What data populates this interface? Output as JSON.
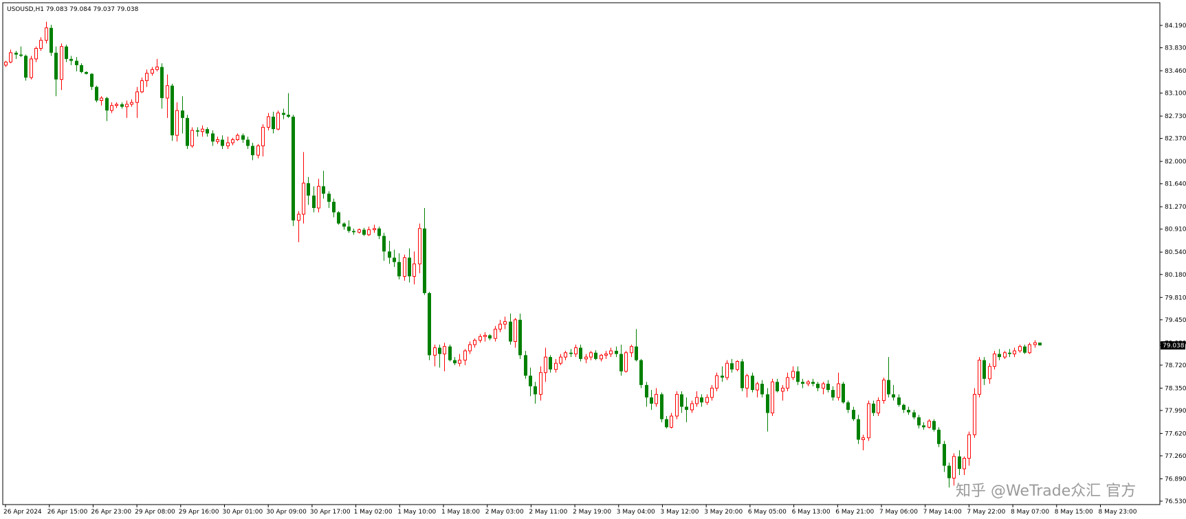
{
  "chart_data": {
    "type": "candlestick",
    "title": "USOUSD,H1  79.083 79.084 79.037 79.038",
    "symbol": "USOUSD",
    "timeframe": "H1",
    "last_price_label": "79.038",
    "watermark": "知乎 @WeTrade众汇 官方",
    "y_range": [
      76.53,
      84.45
    ],
    "y_ticks": [
      "84.190",
      "83.830",
      "83.460",
      "83.100",
      "82.730",
      "82.370",
      "82.000",
      "81.640",
      "81.270",
      "80.910",
      "80.540",
      "80.180",
      "79.810",
      "79.450",
      "79.080",
      "78.720",
      "78.350",
      "77.990",
      "77.620",
      "77.260",
      "76.890",
      "76.530"
    ],
    "x_labels": [
      "26 Apr 2024",
      "26 Apr 15:00",
      "26 Apr 23:00",
      "29 Apr 08:00",
      "29 Apr 16:00",
      "30 Apr 01:00",
      "30 Apr 09:00",
      "30 Apr 17:00",
      "1 May 02:00",
      "1 May 10:00",
      "1 May 18:00",
      "2 May 03:00",
      "2 May 11:00",
      "2 May 19:00",
      "3 May 04:00",
      "3 May 12:00",
      "3 May 20:00",
      "6 May 05:00",
      "6 May 13:00",
      "6 May 21:00",
      "7 May 06:00",
      "7 May 14:00",
      "7 May 22:00",
      "8 May 07:00",
      "8 May 15:00",
      "8 May 23:00"
    ],
    "up_color": "#ff0000",
    "down_color": "#008000",
    "grid": false,
    "candles": [
      [
        83.55,
        83.62,
        83.52,
        83.6
      ],
      [
        83.6,
        83.8,
        83.58,
        83.75
      ],
      [
        83.75,
        83.78,
        83.65,
        83.72
      ],
      [
        83.72,
        83.85,
        83.68,
        83.7
      ],
      [
        83.7,
        83.72,
        83.3,
        83.35
      ],
      [
        83.35,
        83.7,
        83.32,
        83.65
      ],
      [
        83.65,
        83.85,
        83.6,
        83.82
      ],
      [
        83.82,
        84.0,
        83.78,
        83.95
      ],
      [
        83.95,
        84.25,
        83.9,
        84.15
      ],
      [
        84.15,
        84.2,
        83.7,
        83.75
      ],
      [
        83.75,
        83.85,
        83.05,
        83.32
      ],
      [
        83.32,
        83.9,
        83.15,
        83.85
      ],
      [
        83.85,
        83.88,
        83.6,
        83.65
      ],
      [
        83.65,
        83.7,
        83.55,
        83.62
      ],
      [
        83.62,
        83.68,
        83.45,
        83.55
      ],
      [
        83.55,
        83.58,
        83.42,
        83.44
      ],
      [
        83.44,
        83.45,
        83.4,
        83.41
      ],
      [
        83.41,
        83.42,
        83.15,
        83.2
      ],
      [
        83.2,
        83.22,
        82.95,
        82.98
      ],
      [
        82.98,
        83.05,
        82.9,
        83.02
      ],
      [
        83.02,
        83.04,
        82.65,
        82.82
      ],
      [
        82.82,
        82.95,
        82.78,
        82.9
      ],
      [
        82.9,
        82.95,
        82.86,
        82.92
      ],
      [
        82.92,
        82.95,
        82.85,
        82.88
      ],
      [
        82.88,
        82.98,
        82.7,
        82.92
      ],
      [
        82.92,
        83.0,
        82.88,
        82.95
      ],
      [
        82.95,
        83.2,
        82.7,
        83.12
      ],
      [
        83.12,
        83.35,
        83.1,
        83.3
      ],
      [
        83.3,
        83.48,
        83.2,
        83.42
      ],
      [
        83.42,
        83.52,
        83.38,
        83.48
      ],
      [
        83.48,
        83.65,
        83.45,
        83.52
      ],
      [
        83.52,
        83.58,
        82.85,
        83.02
      ],
      [
        83.02,
        83.4,
        82.7,
        83.22
      ],
      [
        83.22,
        83.25,
        82.33,
        82.42
      ],
      [
        82.42,
        82.95,
        82.32,
        82.82
      ],
      [
        82.82,
        83.05,
        82.45,
        82.7
      ],
      [
        82.7,
        82.75,
        82.2,
        82.25
      ],
      [
        82.25,
        82.55,
        82.22,
        82.5
      ],
      [
        82.5,
        82.55,
        82.4,
        82.48
      ],
      [
        82.48,
        82.58,
        82.4,
        82.52
      ],
      [
        82.52,
        82.55,
        82.4,
        82.45
      ],
      [
        82.45,
        82.5,
        82.25,
        82.32
      ],
      [
        82.32,
        82.4,
        82.28,
        82.35
      ],
      [
        82.35,
        82.42,
        82.2,
        82.25
      ],
      [
        82.25,
        82.4,
        82.2,
        82.3
      ],
      [
        82.3,
        82.38,
        82.26,
        82.35
      ],
      [
        82.35,
        82.45,
        82.33,
        82.42
      ],
      [
        82.42,
        82.45,
        82.3,
        82.35
      ],
      [
        82.35,
        82.4,
        82.2,
        82.25
      ],
      [
        82.25,
        82.3,
        82.02,
        82.1
      ],
      [
        82.1,
        82.28,
        82.05,
        82.25
      ],
      [
        82.25,
        82.6,
        82.08,
        82.55
      ],
      [
        82.55,
        82.78,
        82.5,
        82.72
      ],
      [
        82.72,
        82.8,
        82.45,
        82.52
      ],
      [
        82.52,
        82.82,
        82.5,
        82.78
      ],
      [
        82.78,
        82.85,
        82.68,
        82.75
      ],
      [
        82.75,
        83.1,
        82.7,
        82.72
      ],
      [
        82.72,
        82.75,
        80.96,
        81.05
      ],
      [
        81.05,
        81.2,
        80.7,
        81.15
      ],
      [
        81.15,
        82.15,
        81.0,
        81.65
      ],
      [
        81.65,
        81.75,
        81.3,
        81.45
      ],
      [
        81.45,
        81.6,
        81.18,
        81.25
      ],
      [
        81.25,
        81.72,
        81.18,
        81.6
      ],
      [
        81.6,
        81.85,
        81.4,
        81.48
      ],
      [
        81.48,
        81.52,
        81.25,
        81.35
      ],
      [
        81.35,
        81.4,
        81.1,
        81.18
      ],
      [
        81.18,
        81.2,
        80.98,
        81.0
      ],
      [
        81.0,
        81.02,
        80.9,
        80.95
      ],
      [
        80.95,
        81.05,
        80.85,
        80.88
      ],
      [
        80.88,
        80.92,
        80.82,
        80.86
      ],
      [
        80.86,
        80.92,
        80.84,
        80.9
      ],
      [
        80.9,
        80.93,
        80.8,
        80.82
      ],
      [
        80.82,
        80.95,
        80.8,
        80.9
      ],
      [
        80.9,
        80.98,
        80.85,
        80.92
      ],
      [
        80.92,
        80.95,
        80.75,
        80.8
      ],
      [
        80.8,
        80.85,
        80.4,
        80.55
      ],
      [
        80.55,
        80.72,
        80.35,
        80.45
      ],
      [
        80.45,
        80.58,
        80.3,
        80.38
      ],
      [
        80.38,
        80.52,
        80.1,
        80.15
      ],
      [
        80.15,
        80.5,
        80.08,
        80.45
      ],
      [
        80.45,
        80.6,
        80.05,
        80.15
      ],
      [
        80.15,
        80.55,
        80.02,
        80.35
      ],
      [
        80.35,
        81.0,
        80.2,
        80.92
      ],
      [
        80.92,
        81.25,
        79.85,
        79.88
      ],
      [
        79.88,
        79.9,
        78.8,
        78.88
      ],
      [
        78.88,
        79.05,
        78.7,
        79.0
      ],
      [
        79.0,
        79.05,
        78.68,
        78.9
      ],
      [
        78.9,
        79.08,
        78.62,
        79.02
      ],
      [
        79.02,
        79.05,
        78.78,
        78.8
      ],
      [
        78.8,
        78.85,
        78.72,
        78.75
      ],
      [
        78.75,
        78.9,
        78.7,
        78.8
      ],
      [
        78.8,
        78.98,
        78.72,
        78.95
      ],
      [
        78.95,
        79.1,
        78.9,
        79.05
      ],
      [
        79.05,
        79.15,
        79.0,
        79.12
      ],
      [
        79.12,
        79.22,
        79.08,
        79.18
      ],
      [
        79.18,
        79.25,
        79.1,
        79.2
      ],
      [
        79.2,
        79.22,
        79.12,
        79.15
      ],
      [
        79.15,
        79.35,
        79.1,
        79.3
      ],
      [
        79.3,
        79.45,
        79.25,
        79.38
      ],
      [
        79.38,
        79.5,
        79.3,
        79.42
      ],
      [
        79.42,
        79.55,
        79.05,
        79.1
      ],
      [
        79.1,
        79.48,
        79.0,
        79.45
      ],
      [
        79.45,
        79.55,
        78.82,
        78.88
      ],
      [
        78.88,
        78.95,
        78.5,
        78.55
      ],
      [
        78.55,
        78.68,
        78.22,
        78.38
      ],
      [
        78.38,
        78.45,
        78.1,
        78.25
      ],
      [
        78.25,
        78.7,
        78.15,
        78.6
      ],
      [
        78.6,
        79.0,
        78.45,
        78.85
      ],
      [
        78.85,
        78.88,
        78.6,
        78.65
      ],
      [
        78.65,
        78.82,
        78.6,
        78.75
      ],
      [
        78.75,
        78.9,
        78.72,
        78.85
      ],
      [
        78.85,
        78.95,
        78.8,
        78.92
      ],
      [
        78.92,
        78.98,
        78.85,
        78.9
      ],
      [
        78.9,
        79.05,
        78.85,
        79.0
      ],
      [
        79.0,
        79.05,
        78.78,
        78.82
      ],
      [
        78.82,
        78.9,
        78.75,
        78.85
      ],
      [
        78.85,
        78.95,
        78.8,
        78.92
      ],
      [
        78.92,
        78.96,
        78.8,
        78.82
      ],
      [
        78.82,
        78.9,
        78.78,
        78.88
      ],
      [
        78.88,
        78.95,
        78.82,
        78.9
      ],
      [
        78.9,
        79.0,
        78.85,
        78.95
      ],
      [
        78.95,
        79.02,
        78.85,
        78.9
      ],
      [
        78.9,
        79.05,
        78.55,
        78.62
      ],
      [
        78.62,
        78.95,
        78.6,
        78.92
      ],
      [
        78.92,
        79.05,
        78.85,
        79.02
      ],
      [
        79.02,
        79.3,
        78.78,
        78.8
      ],
      [
        78.8,
        78.82,
        78.35,
        78.4
      ],
      [
        78.4,
        78.45,
        78.05,
        78.2
      ],
      [
        78.2,
        78.32,
        78.0,
        78.1
      ],
      [
        78.1,
        78.35,
        78.05,
        78.25
      ],
      [
        78.25,
        78.28,
        77.8,
        77.85
      ],
      [
        77.85,
        77.9,
        77.7,
        77.72
      ],
      [
        77.72,
        77.95,
        77.7,
        77.9
      ],
      [
        77.9,
        78.3,
        77.85,
        78.25
      ],
      [
        78.25,
        78.3,
        77.95,
        78.05
      ],
      [
        78.05,
        78.2,
        77.8,
        78.0
      ],
      [
        78.0,
        78.15,
        77.95,
        78.1
      ],
      [
        78.1,
        78.3,
        78.05,
        78.2
      ],
      [
        78.2,
        78.25,
        78.05,
        78.12
      ],
      [
        78.12,
        78.25,
        78.08,
        78.2
      ],
      [
        78.2,
        78.4,
        78.15,
        78.35
      ],
      [
        78.35,
        78.6,
        78.3,
        78.55
      ],
      [
        78.55,
        78.7,
        78.45,
        78.52
      ],
      [
        78.52,
        78.8,
        78.48,
        78.75
      ],
      [
        78.75,
        78.82,
        78.6,
        78.65
      ],
      [
        78.65,
        78.8,
        78.62,
        78.78
      ],
      [
        78.78,
        78.82,
        78.3,
        78.35
      ],
      [
        78.35,
        78.58,
        78.2,
        78.55
      ],
      [
        78.55,
        78.6,
        78.28,
        78.32
      ],
      [
        78.32,
        78.45,
        78.2,
        78.42
      ],
      [
        78.42,
        78.48,
        78.2,
        78.25
      ],
      [
        78.25,
        78.35,
        77.65,
        77.95
      ],
      [
        77.95,
        78.5,
        77.9,
        78.45
      ],
      [
        78.45,
        78.5,
        78.28,
        78.3
      ],
      [
        78.3,
        78.4,
        78.15,
        78.35
      ],
      [
        78.35,
        78.6,
        78.3,
        78.52
      ],
      [
        78.52,
        78.7,
        78.48,
        78.62
      ],
      [
        78.62,
        78.7,
        78.4,
        78.45
      ],
      [
        78.45,
        78.5,
        78.35,
        78.42
      ],
      [
        78.42,
        78.48,
        78.38,
        78.45
      ],
      [
        78.45,
        78.5,
        78.38,
        78.42
      ],
      [
        78.42,
        78.45,
        78.3,
        78.35
      ],
      [
        78.35,
        78.45,
        78.25,
        78.42
      ],
      [
        78.42,
        78.48,
        78.28,
        78.32
      ],
      [
        78.32,
        78.38,
        78.15,
        78.2
      ],
      [
        78.2,
        78.6,
        78.15,
        78.42
      ],
      [
        78.42,
        78.45,
        78.1,
        78.12
      ],
      [
        78.12,
        78.15,
        77.95,
        78.0
      ],
      [
        78.0,
        78.05,
        77.82,
        77.85
      ],
      [
        77.85,
        77.92,
        77.45,
        77.52
      ],
      [
        77.52,
        77.6,
        77.35,
        77.55
      ],
      [
        77.55,
        78.15,
        77.5,
        78.1
      ],
      [
        78.1,
        78.15,
        77.9,
        77.95
      ],
      [
        77.95,
        78.2,
        77.9,
        78.15
      ],
      [
        78.15,
        78.52,
        78.1,
        78.48
      ],
      [
        78.48,
        78.85,
        78.2,
        78.25
      ],
      [
        78.25,
        78.4,
        78.15,
        78.2
      ],
      [
        78.2,
        78.25,
        78.05,
        78.08
      ],
      [
        78.08,
        78.1,
        77.95,
        78.0
      ],
      [
        78.0,
        78.05,
        77.92,
        77.96
      ],
      [
        77.96,
        78.0,
        77.85,
        77.88
      ],
      [
        77.88,
        77.92,
        77.7,
        77.75
      ],
      [
        77.75,
        77.8,
        77.68,
        77.72
      ],
      [
        77.72,
        77.85,
        77.7,
        77.82
      ],
      [
        77.82,
        77.85,
        77.65,
        77.68
      ],
      [
        77.68,
        77.72,
        77.4,
        77.45
      ],
      [
        77.45,
        77.5,
        77.0,
        77.1
      ],
      [
        77.1,
        77.15,
        76.75,
        76.9
      ],
      [
        76.9,
        77.3,
        76.78,
        77.25
      ],
      [
        77.25,
        77.35,
        76.95,
        77.05
      ],
      [
        77.05,
        77.25,
        76.95,
        77.22
      ],
      [
        77.22,
        77.65,
        77.1,
        77.6
      ],
      [
        77.6,
        78.35,
        77.55,
        78.25
      ],
      [
        78.25,
        78.85,
        78.2,
        78.8
      ],
      [
        78.8,
        78.85,
        78.4,
        78.5
      ],
      [
        78.5,
        78.75,
        78.42,
        78.7
      ],
      [
        78.7,
        78.95,
        78.65,
        78.9
      ],
      [
        78.9,
        78.98,
        78.8,
        78.85
      ],
      [
        78.85,
        78.95,
        78.82,
        78.92
      ],
      [
        78.92,
        78.98,
        78.85,
        78.9
      ],
      [
        78.9,
        79.0,
        78.85,
        78.95
      ],
      [
        78.95,
        79.05,
        78.92,
        79.02
      ],
      [
        79.02,
        79.05,
        78.9,
        78.92
      ],
      [
        78.92,
        79.08,
        78.9,
        79.05
      ],
      [
        79.05,
        79.12,
        79.0,
        79.08
      ],
      [
        79.083,
        79.084,
        79.037,
        79.038
      ]
    ]
  }
}
